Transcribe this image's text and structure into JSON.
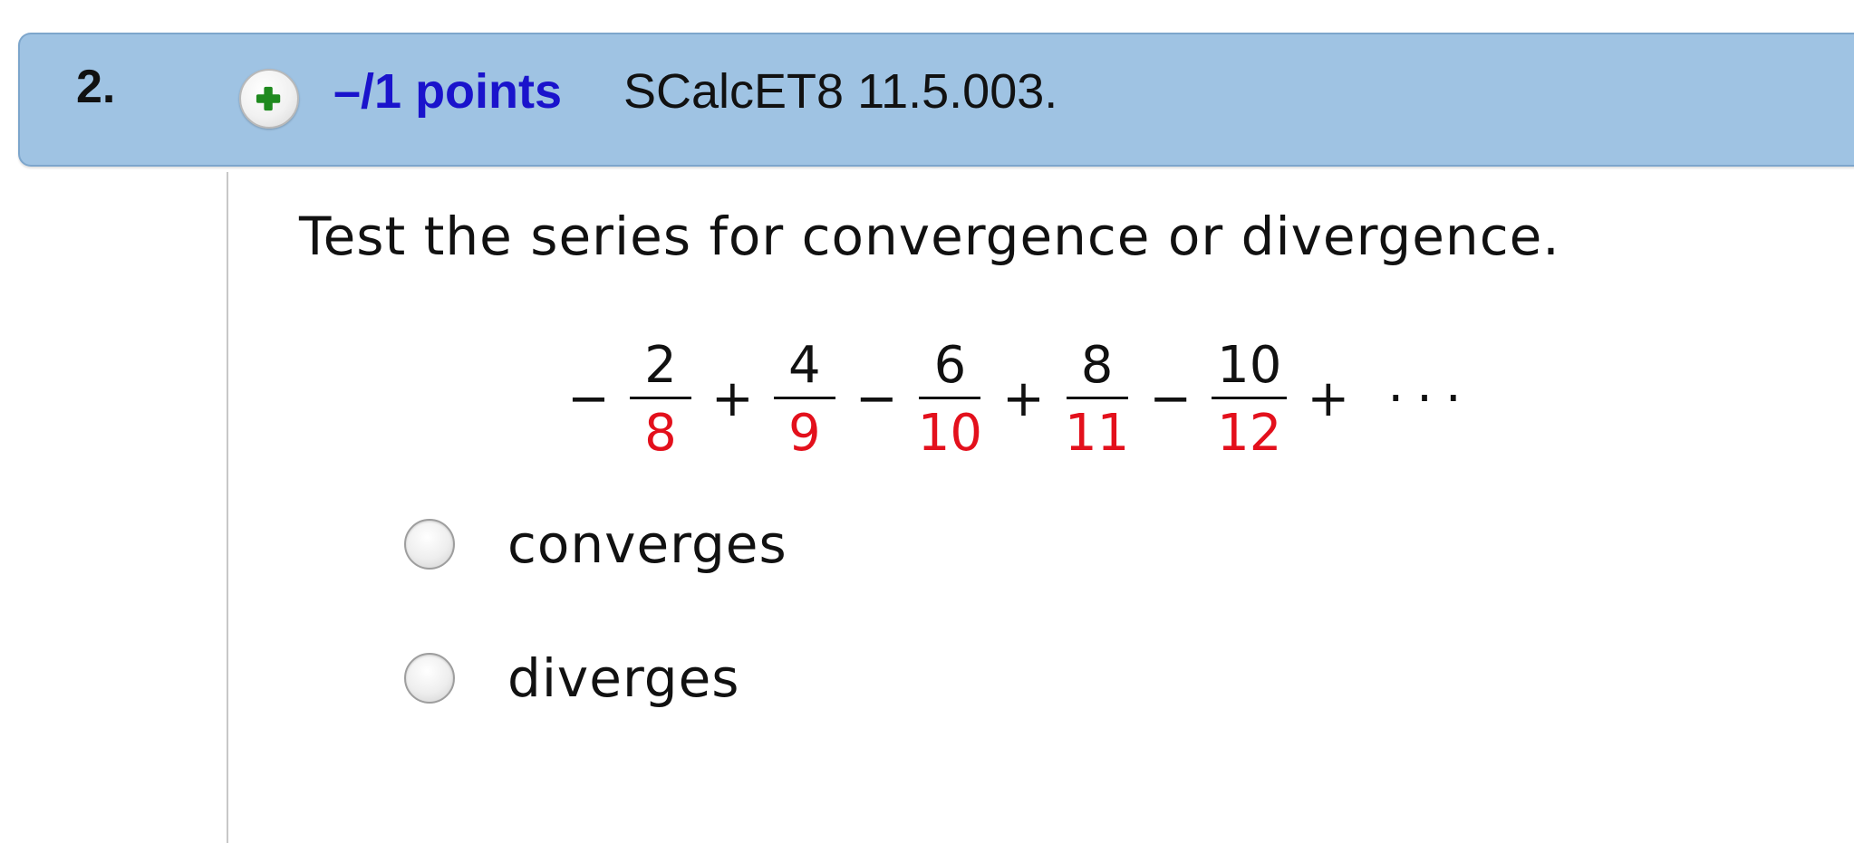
{
  "question": {
    "number": "2.",
    "points": "–/1 points",
    "reference": "SCalcET8 11.5.003.",
    "expand_icon": "plus-circle-icon",
    "colors": {
      "header_background": "#9fc3e3",
      "points_text": "#1a13cc",
      "plus_icon": "#1f8a1f",
      "denominator": "#e3101c"
    }
  },
  "prompt": "Test the series for convergence or divergence.",
  "series": {
    "terms": [
      {
        "sign": "−",
        "numerator": "2",
        "denominator": "8"
      },
      {
        "sign": "+",
        "numerator": "4",
        "denominator": "9"
      },
      {
        "sign": "−",
        "numerator": "6",
        "denominator": "10"
      },
      {
        "sign": "+",
        "numerator": "8",
        "denominator": "11"
      },
      {
        "sign": "−",
        "numerator": "10",
        "denominator": "12"
      }
    ],
    "trailing_sign": "+",
    "ellipsis": "···"
  },
  "options": [
    {
      "label": "converges",
      "selected": false
    },
    {
      "label": "diverges",
      "selected": false
    }
  ]
}
